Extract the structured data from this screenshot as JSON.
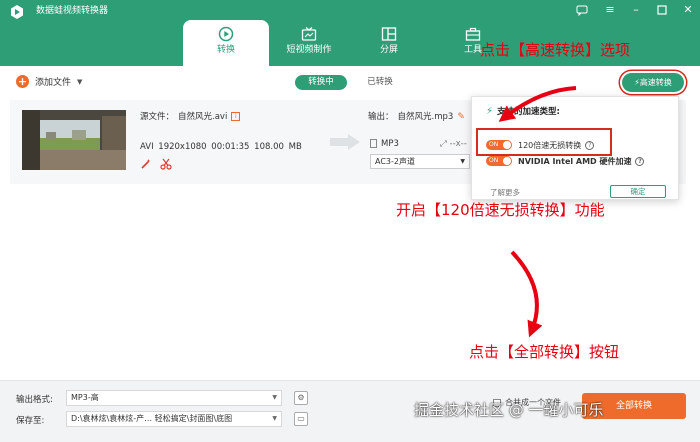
{
  "app": {
    "title": "数据蛙视频转换器",
    "accent_color": "#2e9e77",
    "orange_color": "#ee6b2c"
  },
  "window_controls": [
    "chat-icon",
    "menu-icon",
    "minimize-icon",
    "maximize-icon",
    "close-icon"
  ],
  "nav": {
    "tabs": [
      {
        "label": "转换",
        "icon": "convert-icon",
        "active": true
      },
      {
        "label": "短视频制作",
        "icon": "short-video-icon",
        "active": false
      },
      {
        "label": "分屏",
        "icon": "split-screen-icon",
        "active": false
      },
      {
        "label": "工具",
        "icon": "toolbox-icon",
        "active": false
      }
    ]
  },
  "toolbar": {
    "add_file_label": "添加文件",
    "tab_converting": "转换中",
    "tab_converted": "已转换",
    "speed_button_label": "高速转换"
  },
  "file": {
    "source_label": "源文件：",
    "source_name": "自然风光.avi",
    "meta": "AVI  1920x1080  00:01:35  108.00 MB",
    "output_label": "输出：",
    "output_name": "自然风光.mp3",
    "output_format": "MP3",
    "output_res": "--x--",
    "audio_channel": "AC3-2声道"
  },
  "popup": {
    "title": "支持的加速类型:",
    "option1_label": "120倍速无损转换",
    "option2_label": "NVIDIA   Intel   AMD  硬件加速",
    "toggle_text": "ON",
    "link": "了解更多",
    "ok_label": "确定"
  },
  "annotations": {
    "a1": "点击【高速转换】选项",
    "a2": "开启【120倍速无损转换】功能",
    "a3": "点击【全部转换】按钮",
    "color": "#e60012"
  },
  "bottom": {
    "format_label": "输出格式:",
    "format_value": "MP3-高",
    "save_label": "保存至:",
    "save_path": "D:\\袁林炫\\袁林炫-产…  轻松搞定\\封面图\\底图",
    "merge_label": "合并成一个文件",
    "convert_all_label": "全部转换"
  },
  "watermark": "掘金技术社区 @ 一罐小可乐"
}
